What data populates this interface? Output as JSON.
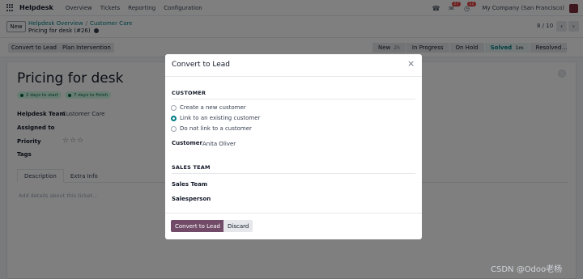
{
  "navbar": {
    "brand": "Helpdesk",
    "menu": [
      "Overview",
      "Tickets",
      "Reporting",
      "Configuration"
    ],
    "chat_badge": "27",
    "activity_badge": "12",
    "company": "My Company (San Francisco)"
  },
  "control": {
    "new_label": "New",
    "breadcrumb": [
      "Helpdesk Overview",
      "Customer Care"
    ],
    "breadcrumb_sep": "/",
    "record_title": "Pricing for desk (#26)",
    "pager": "8 / 10"
  },
  "actions": {
    "convert_to_lead": "Convert to Lead",
    "plan_intervention": "Plan Intervention"
  },
  "stages": [
    {
      "label": "New",
      "count": "2h"
    },
    {
      "label": "In Progress",
      "count": ""
    },
    {
      "label": "On Hold",
      "count": ""
    },
    {
      "label": "Solved",
      "count": "1m"
    },
    {
      "label": "Resolved",
      "count": ""
    }
  ],
  "stage_more": "...",
  "form": {
    "title": "Pricing for desk",
    "sla": [
      "2 days to start",
      "7 days to finish"
    ],
    "fields": {
      "helpdesk_team_label": "Helpdesk Team",
      "helpdesk_team_value": "Customer Care",
      "assigned_to_label": "Assigned to",
      "priority_label": "Priority",
      "priority_stars": "☆☆☆",
      "tags_label": "Tags"
    },
    "tabs": [
      "Description",
      "Extra Info"
    ],
    "description_placeholder": "Add details about this ticket..."
  },
  "modal": {
    "title": "Convert to Lead",
    "close": "×",
    "customer_section": "CUSTOMER",
    "options": [
      {
        "label": "Create a new customer",
        "checked": false
      },
      {
        "label": "Link to an existing customer",
        "checked": true
      },
      {
        "label": "Do not link to a customer",
        "checked": false
      }
    ],
    "customer_label": "Customer",
    "customer_value": "Anita Oliver",
    "sales_section": "SALES TEAM",
    "sales_team_label": "Sales Team",
    "salesperson_label": "Salesperson",
    "convert_button": "Convert to Lead",
    "discard_button": "Discard"
  },
  "watermark": "CSDN @Odoo老杨",
  "colors": {
    "brand": "#714b67",
    "teal": "#017e84",
    "badge": "#e03c3c"
  }
}
